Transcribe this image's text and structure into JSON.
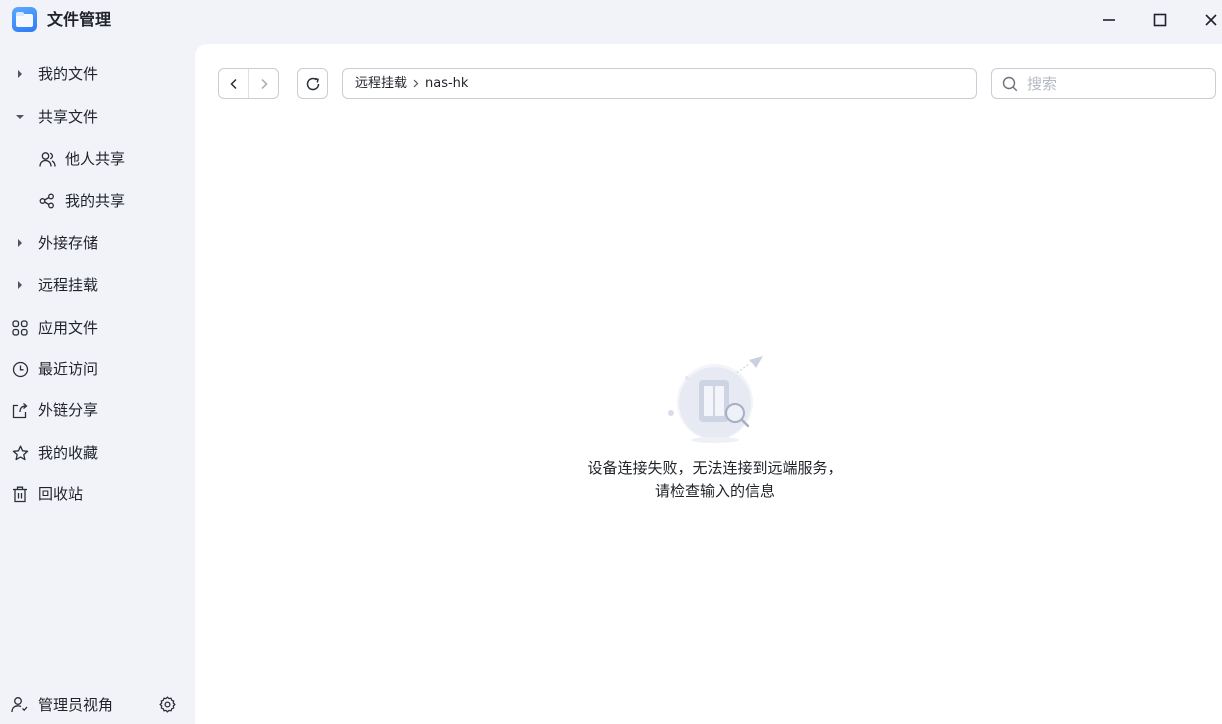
{
  "app": {
    "title": "文件管理",
    "icon": "folder-app-icon"
  },
  "window_controls": {
    "minimize": "minimize-icon",
    "maximize": "maximize-icon",
    "close": "close-icon"
  },
  "sidebar": {
    "items": [
      {
        "label": "我的文件",
        "icon": "caret-right-icon",
        "expanded": false
      },
      {
        "label": "共享文件",
        "icon": "caret-down-icon",
        "expanded": true
      },
      {
        "label": "他人共享",
        "icon": "users-icon",
        "sub": true
      },
      {
        "label": "我的共享",
        "icon": "share-icon",
        "sub": true
      },
      {
        "label": "外接存储",
        "icon": "caret-right-icon",
        "expanded": false
      },
      {
        "label": "远程挂载",
        "icon": "caret-right-icon",
        "expanded": false
      },
      {
        "label": "应用文件",
        "icon": "apps-grid-icon"
      },
      {
        "label": "最近访问",
        "icon": "clock-icon"
      },
      {
        "label": "外链分享",
        "icon": "external-share-icon"
      },
      {
        "label": "我的收藏",
        "icon": "star-icon"
      },
      {
        "label": "回收站",
        "icon": "trash-icon"
      }
    ],
    "footer": {
      "label": "管理员视角",
      "icon": "admin-user-icon",
      "settings_icon": "gear-icon"
    }
  },
  "toolbar": {
    "back_icon": "chevron-left-icon",
    "forward_icon": "chevron-right-icon",
    "refresh_icon": "refresh-icon",
    "breadcrumb": [
      "远程挂载",
      "nas-hk"
    ],
    "search_placeholder": "搜索"
  },
  "empty_state": {
    "illustration": "server-search-illustration",
    "line1": "设备连接失败，无法连接到远端服务，",
    "line2": "请检查输入的信息"
  },
  "colors": {
    "sidebar_bg": "#f1f3f8",
    "content_bg": "#ffffff",
    "accent": "#2f7bf5",
    "border": "#c9cdd4",
    "placeholder": "#b5b9c2"
  }
}
